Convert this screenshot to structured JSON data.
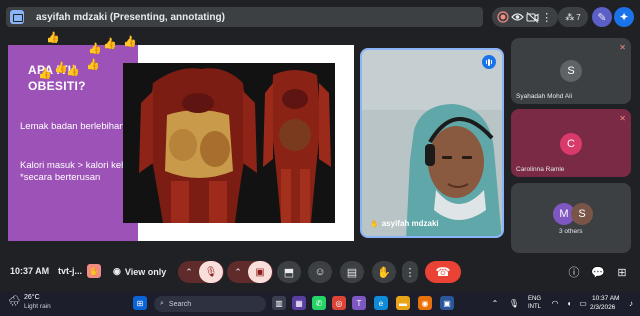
{
  "window": {
    "presenting_title": "asyifah mdzaki (Presenting, annotating)",
    "people_count": "7"
  },
  "slide": {
    "title": "APA ITU OBESITI?",
    "bullet1": "Lemak badan berlebihan",
    "bullet2": "Kalori masuk > kalori keluar *secara berterusan"
  },
  "main_participant": {
    "name": "asyifah mdzaki"
  },
  "side_participants": [
    {
      "initial": "S",
      "name": "Syahadah Mohd Ali",
      "avatar_color": "#5f6368"
    },
    {
      "initial": "C",
      "name": "Carolinna Ramle",
      "avatar_color": "#c2185b"
    },
    {
      "initials": [
        "M",
        "S"
      ],
      "label": "3 others",
      "avatar_colors": [
        "#7e57c2",
        "#795548"
      ]
    }
  ],
  "bottom_bar": {
    "time": "10:37 AM",
    "meeting_code": "tvt-j...",
    "view_only": "View only"
  },
  "taskbar": {
    "weather_temp": "26°C",
    "weather_desc": "Light rain",
    "search_placeholder": "Search",
    "lang_top": "ENG",
    "lang_bottom": "INTL",
    "clock_time": "10:37 AM",
    "clock_date": "2/3/2026"
  },
  "colors": {
    "slide_purple": "#9d52b8",
    "end_call": "#ea4335",
    "accent_blue": "#8ab4f8",
    "side_tile_pink": "#7a2a45"
  }
}
